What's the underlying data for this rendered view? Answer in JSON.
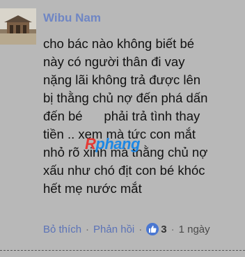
{
  "comment": {
    "author": "Wibu Nam",
    "lines": [
      "cho bác nào không biết bé",
      "này có người thân đi vay",
      "nặng lãi không trả được lên",
      "bị thằng chủ nợ đến phá dấn",
      "đến bé      phải trả tình thay",
      "tiền .. xem mà tức con mắt",
      "nhỏ rõ xinh mà thằng chủ nợ",
      "xấu như chó địt con bé khóc",
      "hết mẹ nước mắt"
    ],
    "actions": {
      "like_label": "Bỏ thích",
      "reply_label": "Phản hồi",
      "like_count": "3",
      "time": "1 ngày"
    }
  },
  "watermark": {
    "first_letter": "R",
    "rest": "phang"
  },
  "colors": {
    "background": "#b8b8b8",
    "link": "#5b73b7",
    "author": "#6f86c4",
    "like_icon": "#4a77d1"
  },
  "icons": {
    "like": "thumbs-up-icon"
  }
}
